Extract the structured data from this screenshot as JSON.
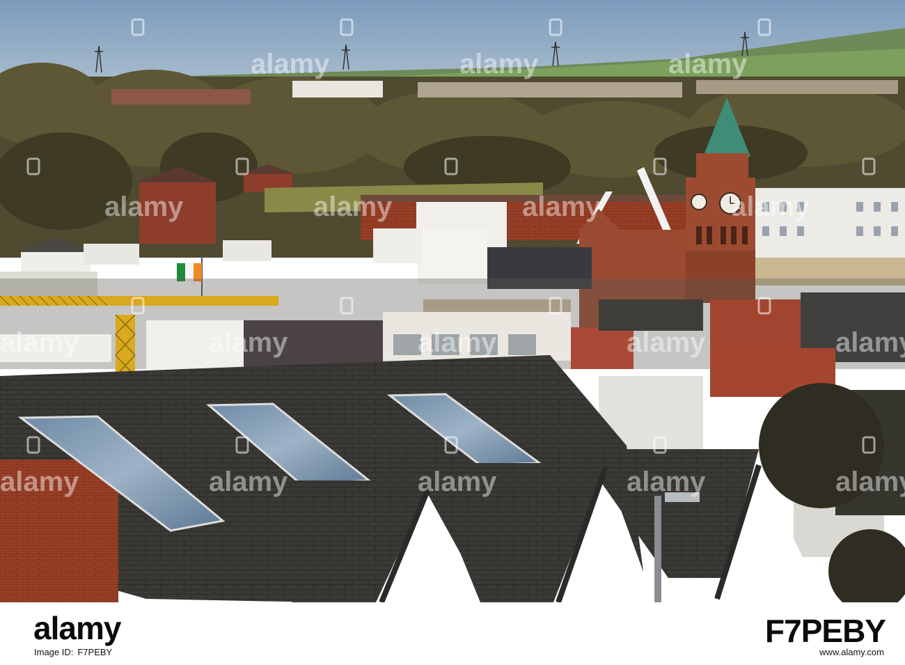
{
  "watermark": {
    "brand": "alamy"
  },
  "footer": {
    "logo": "alamy",
    "image_id_label": "Image ID:",
    "image_id": "F7PEBY",
    "image_id_big": "F7PEBY",
    "url": "www.alamy.com"
  },
  "colors": {
    "sky": "#7f9fbf",
    "roof": "#3a3834",
    "brick": "#8c3a24",
    "clock_tower": "#9a4a30",
    "spire": "#3f8c78",
    "flag_green": "#1e8c3a",
    "flag_orange": "#f08a24",
    "crane": "#e0b020"
  }
}
